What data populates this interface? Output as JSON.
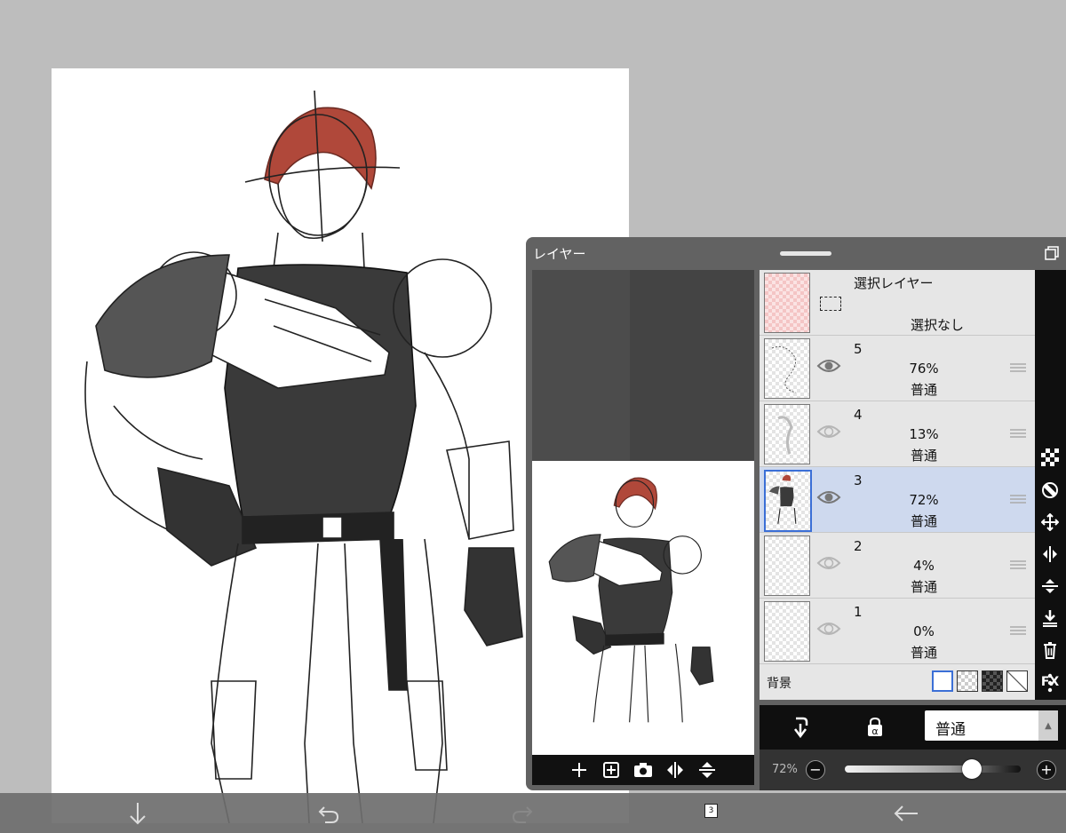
{
  "panel": {
    "title": "レイヤー"
  },
  "selection_layer": {
    "name": "選択レイヤー",
    "status": "選択なし"
  },
  "layers": [
    {
      "number": "5",
      "opacity": "76%",
      "blend": "普通",
      "visible": true,
      "selected": false
    },
    {
      "number": "4",
      "opacity": "13%",
      "blend": "普通",
      "visible": false,
      "selected": false
    },
    {
      "number": "3",
      "opacity": "72%",
      "blend": "普通",
      "visible": true,
      "selected": true
    },
    {
      "number": "2",
      "opacity": "4%",
      "blend": "普通",
      "visible": false,
      "selected": false
    },
    {
      "number": "1",
      "opacity": "0%",
      "blend": "普通",
      "visible": false,
      "selected": false
    }
  ],
  "background_row": {
    "label": "背景"
  },
  "side_rail": {
    "fx_label": "FX"
  },
  "blend_mode": {
    "current": "普通"
  },
  "opacity": {
    "label": "72%",
    "value": 72,
    "minus": "−",
    "plus": "+"
  },
  "bottom_bar": {
    "layer_count": "3"
  },
  "colors": {
    "selected_row": "#ced9ee",
    "accent": "#3b6fd6",
    "hair": "#b0483a"
  }
}
